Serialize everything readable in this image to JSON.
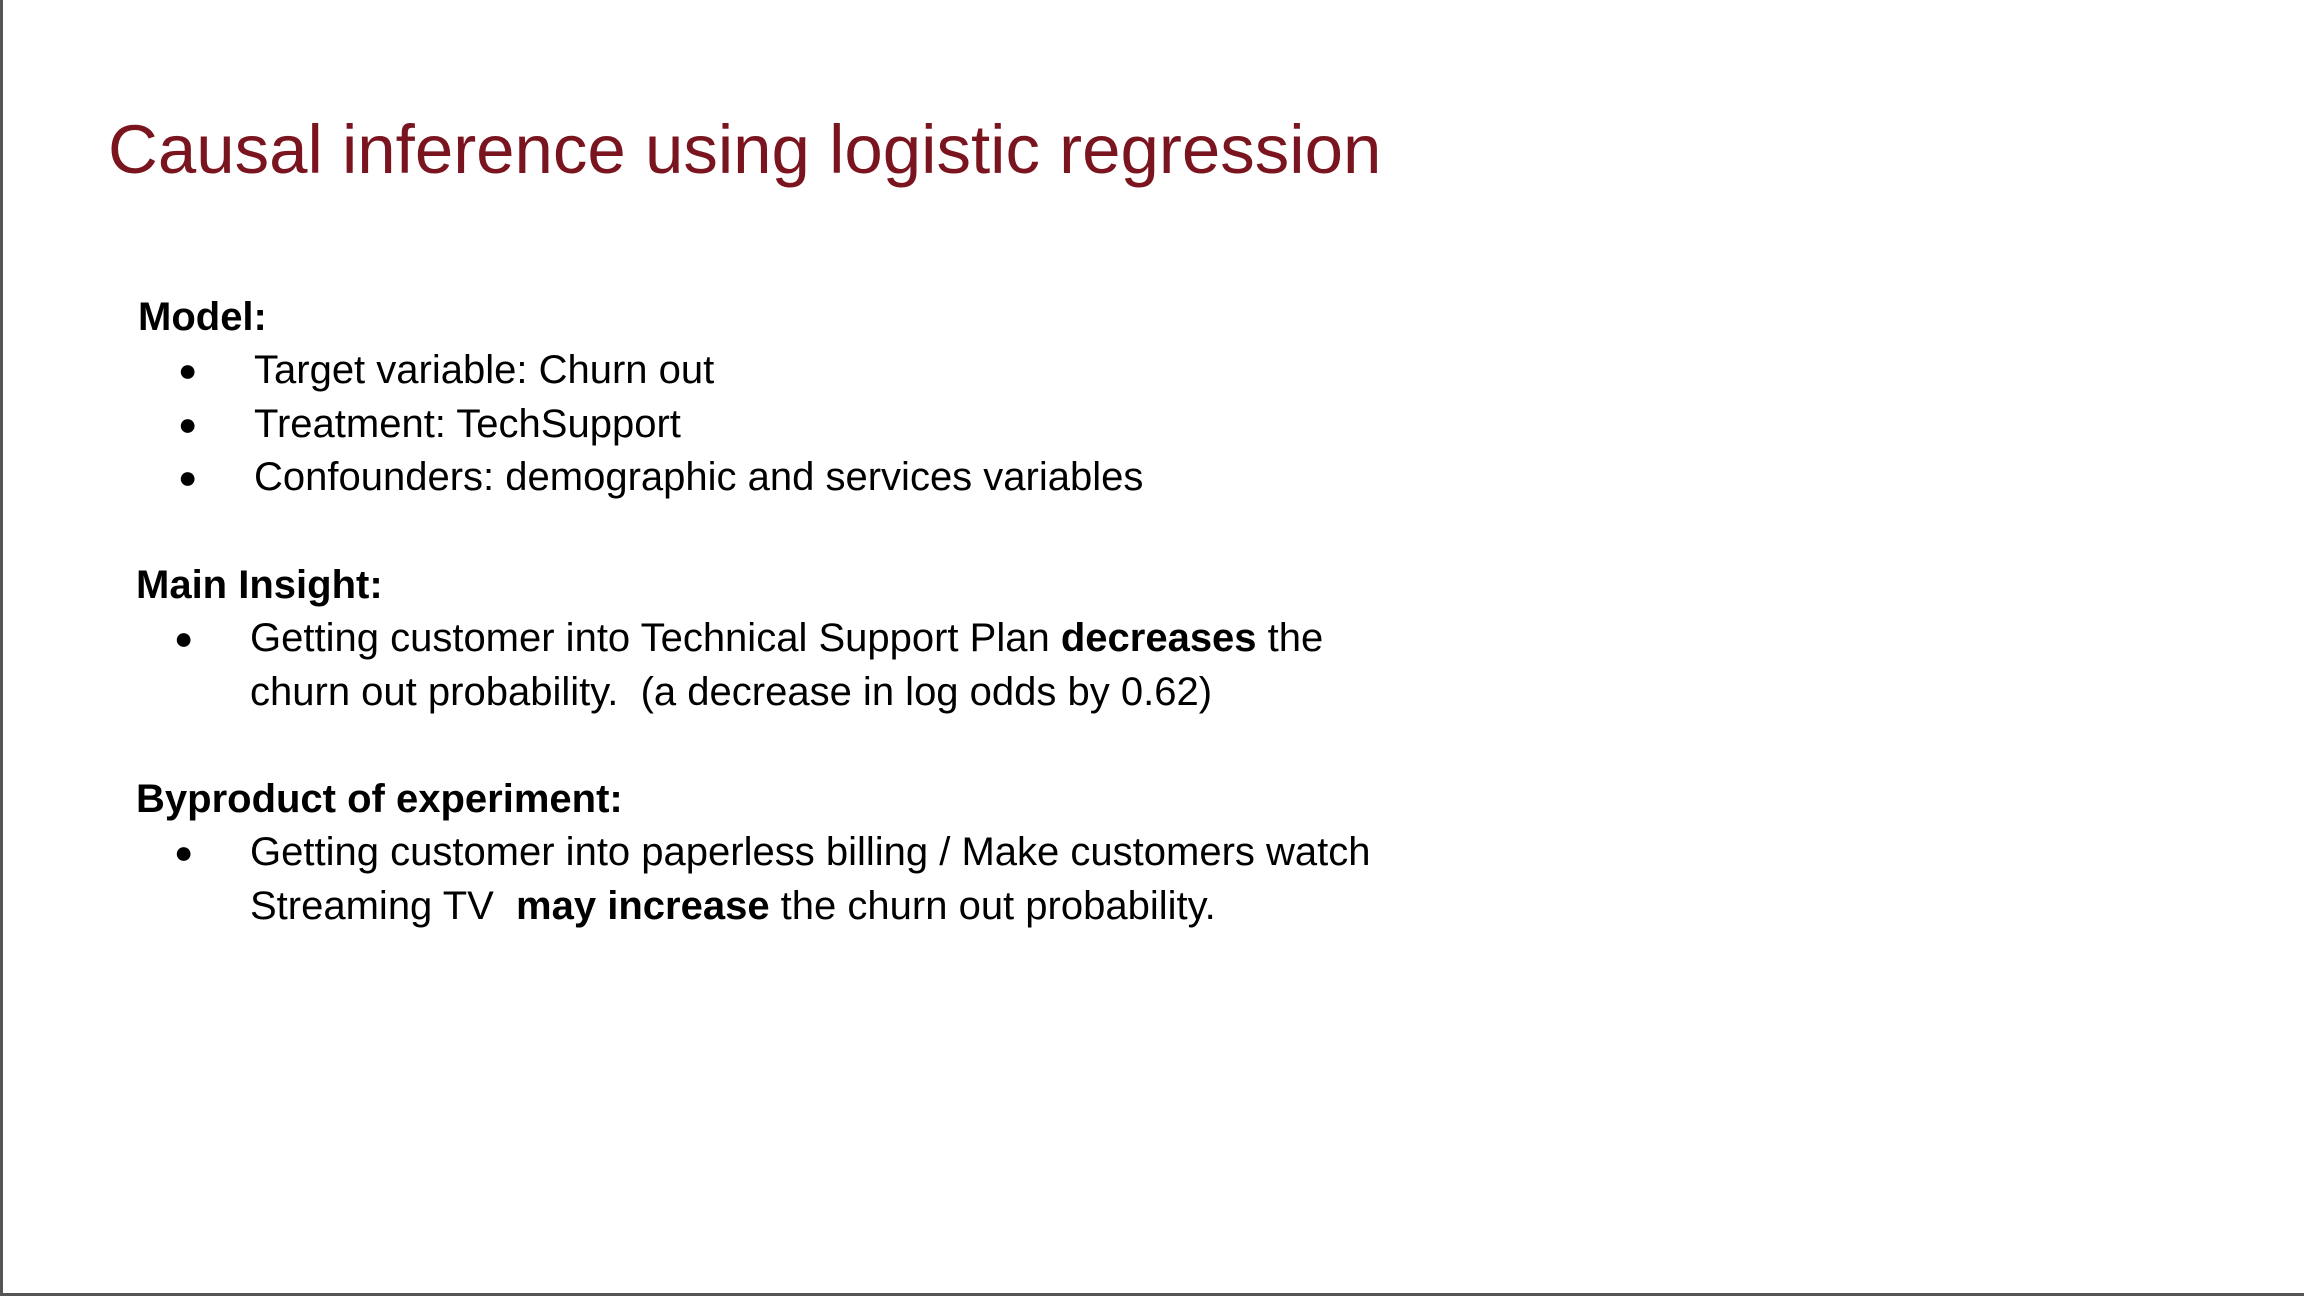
{
  "slide": {
    "title": "Causal inference using logistic regression",
    "title_color": "#7a1520",
    "model": {
      "heading": "Model:",
      "items": [
        "Target variable: Churn out",
        "Treatment: TechSupport",
        "Confounders: demographic and services variables"
      ]
    },
    "insight": {
      "heading": "Main Insight:",
      "line1_pre": "Getting customer into Technical Support Plan ",
      "line1_bold": "decreases",
      "line1_post": " the",
      "line2": "churn out probability.  (a decrease in log odds by 0.62)"
    },
    "byproduct": {
      "heading": "Byproduct of experiment:",
      "line1": "Getting customer into paperless billing / Make customers watch",
      "line2_pre": "Streaming TV  ",
      "line2_bold": "may increase",
      "line2_post": " the churn out probability."
    },
    "bullet_glyph": "●"
  }
}
